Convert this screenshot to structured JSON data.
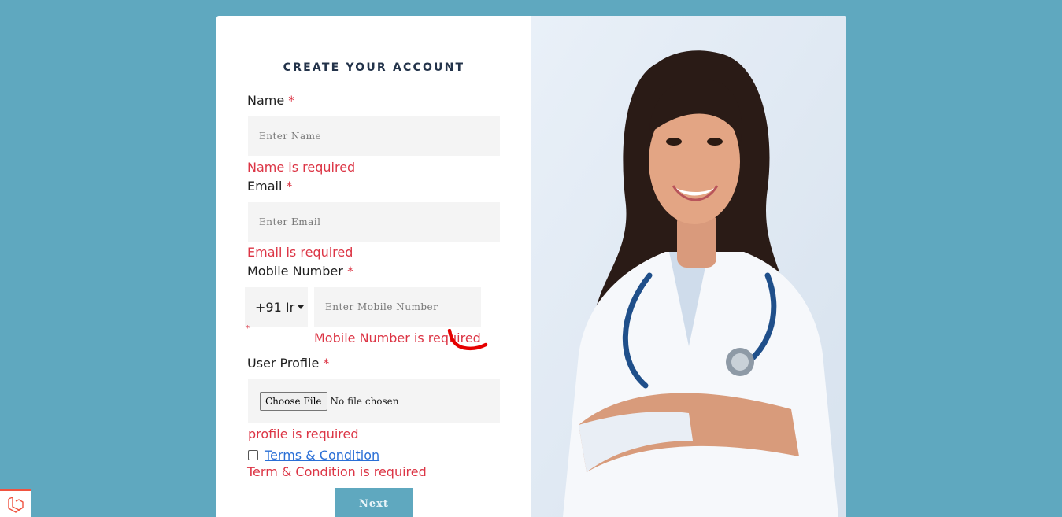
{
  "form": {
    "title": "CREATE YOUR ACCOUNT",
    "required_mark": "*",
    "name": {
      "label": "Name",
      "placeholder": "Enter Name",
      "error": "Name is required"
    },
    "email": {
      "label": "Email",
      "placeholder": "Enter Email",
      "error": "Email is required"
    },
    "mobile": {
      "label": "Mobile Number",
      "country_code": "+91 Ir",
      "placeholder": "Enter Mobile Number",
      "error": "Mobile Number is required"
    },
    "profile": {
      "label": "User Profile",
      "button": "Choose File",
      "status": "No file chosen",
      "error": "profile is required"
    },
    "terms": {
      "link": "Terms & Condition",
      "error": "Term & Condition is required"
    },
    "next_label": "Next"
  },
  "colors": {
    "background": "#5fa8bf",
    "error": "#dc3545",
    "link": "#2a6fd6",
    "annotation": "#e60000"
  },
  "icons": {
    "corner_logo": "laravel-icon",
    "dial_caret": "caret-down-icon"
  }
}
